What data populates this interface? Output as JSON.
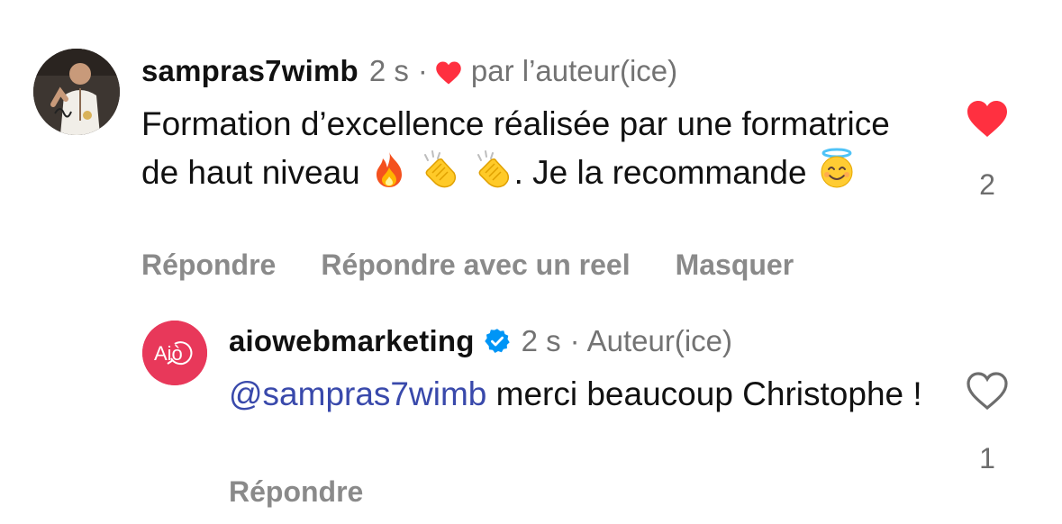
{
  "comment": {
    "username": "sampras7wimb",
    "time": "2 s",
    "separator": "·",
    "liked_by_author": "par l’auteur(ice)",
    "text_part1": "Formation d’excellence réalisée par une formatrice de haut niveau",
    "text_part2": ". Je la recommande",
    "emojis_inline": [
      "fire-emoji",
      "clapping-hands-emoji",
      "clapping-hands-emoji"
    ],
    "emoji_end": "smiling-face-with-halo-emoji",
    "actions": [
      "Répondre",
      "Répondre avec un reel",
      "Masquer"
    ],
    "like_count": "2",
    "liked": true
  },
  "reply": {
    "username": "aiowebmarketing",
    "time": "2 s",
    "separator": "·",
    "author_label": "Auteur(ice)",
    "avatar_text": "Aiò",
    "mention": "@sampras7wimb",
    "text": " merci beaucoup Christophe !",
    "actions": [
      "Répondre"
    ],
    "like_count": "1",
    "liked": false
  },
  "colors": {
    "heart_red": "#ff3040",
    "verified_blue": "#0095f6",
    "mention_blue": "#3949ab",
    "meta_gray": "#737373",
    "brand_avatar": "#e8385a"
  }
}
